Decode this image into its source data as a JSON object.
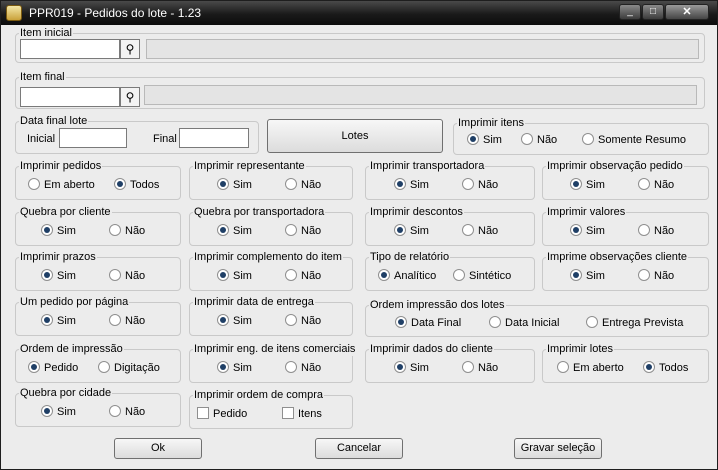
{
  "window": {
    "title": "PPR019 - Pedidos do lote - 1.23"
  },
  "item_inicial": {
    "label": "Item inicial",
    "value": ""
  },
  "item_final": {
    "label": "Item final",
    "value": ""
  },
  "data_final_lote": {
    "label": "Data final lote",
    "inicial_label": "Inicial",
    "final_label": "Final"
  },
  "lotes_button": "Lotes",
  "imprimir_itens": {
    "label": "Imprimir itens",
    "options": [
      "Sim",
      "Não",
      "Somente Resumo"
    ],
    "selected": "Sim"
  },
  "groups": {
    "imprimir_pedidos": {
      "label": "Imprimir pedidos",
      "opt1": "Em aberto",
      "opt2": "Todos",
      "selected": "Todos"
    },
    "imprimir_representante": {
      "label": "Imprimir representante",
      "opt1": "Sim",
      "opt2": "Não",
      "selected": "Sim"
    },
    "imprimir_transportadora": {
      "label": "Imprimir transportadora",
      "opt1": "Sim",
      "opt2": "Não",
      "selected": "Sim"
    },
    "imprimir_observacao_pedido": {
      "label": "Imprimir observação pedido",
      "opt1": "Sim",
      "opt2": "Não",
      "selected": "Sim"
    },
    "quebra_por_cliente": {
      "label": "Quebra por cliente",
      "opt1": "Sim",
      "opt2": "Não",
      "selected": "Sim"
    },
    "quebra_por_transportadora": {
      "label": "Quebra por transportadora",
      "opt1": "Sim",
      "opt2": "Não",
      "selected": "Sim"
    },
    "imprimir_descontos": {
      "label": "Imprimir descontos",
      "opt1": "Sim",
      "opt2": "Não",
      "selected": "Sim"
    },
    "imprimir_valores": {
      "label": "Imprimir valores",
      "opt1": "Sim",
      "opt2": "Não",
      "selected": "Sim"
    },
    "imprimir_prazos": {
      "label": "Imprimir prazos",
      "opt1": "Sim",
      "opt2": "Não",
      "selected": "Sim"
    },
    "imprimir_complemento_item": {
      "label": "Imprimir complemento do item",
      "opt1": "Sim",
      "opt2": "Não",
      "selected": "Sim"
    },
    "tipo_de_relatorio": {
      "label": "Tipo de relatório",
      "opt1": "Analítico",
      "opt2": "Sintético",
      "selected": "Analítico"
    },
    "imprime_observacoes_cliente": {
      "label": "Imprime observações cliente",
      "opt1": "Sim",
      "opt2": "Não",
      "selected": "Sim"
    },
    "um_pedido_por_pagina": {
      "label": "Um pedido por página",
      "opt1": "Sim",
      "opt2": "Não",
      "selected": "Sim"
    },
    "imprimir_data_entrega": {
      "label": "Imprimir data de entrega",
      "opt1": "Sim",
      "opt2": "Não",
      "selected": "Sim"
    },
    "ordem_de_impressao": {
      "label": "Ordem de impressão",
      "opt1": "Pedido",
      "opt2": "Digitação",
      "selected": "Pedido"
    },
    "imprimir_eng_itens_comerciais": {
      "label": "Imprimir eng. de itens comerciais",
      "opt1": "Sim",
      "opt2": "Não",
      "selected": "Sim"
    },
    "imprimir_dados_cliente": {
      "label": "Imprimir dados do cliente",
      "opt1": "Sim",
      "opt2": "Não",
      "selected": "Sim"
    },
    "imprimir_lotes": {
      "label": "Imprimir lotes",
      "opt1": "Em aberto",
      "opt2": "Todos",
      "selected": "Todos"
    },
    "quebra_por_cidade": {
      "label": "Quebra por cidade",
      "opt1": "Sim",
      "opt2": "Não",
      "selected": "Sim"
    }
  },
  "ordem_impressao_lotes": {
    "label": "Ordem impressão dos lotes",
    "opt1": "Data Final",
    "opt2": "Data Inicial",
    "opt3": "Entrega Prevista",
    "selected": "Data Final"
  },
  "imprimir_ordem_compra": {
    "label": "Imprimir ordem de compra",
    "opt1": "Pedido",
    "opt2": "Itens"
  },
  "footer": {
    "ok": "Ok",
    "cancelar": "Cancelar",
    "gravar": "Gravar seleção"
  }
}
